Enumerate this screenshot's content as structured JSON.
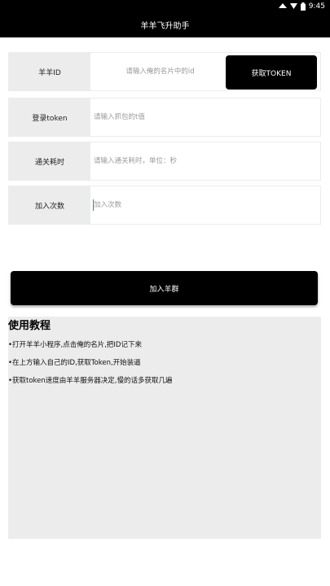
{
  "status_bar": {
    "time": "9:45"
  },
  "app_bar": {
    "title": "羊羊飞升助手"
  },
  "form": {
    "sheep_id": {
      "label": "羊羊ID",
      "placeholder": "请输入俺的名片中的id",
      "button_label": "获取TOKEN"
    },
    "login_token": {
      "label": "登录token",
      "placeholder": "请输入抓包的t值"
    },
    "clear_time": {
      "label": "通关耗时",
      "placeholder": "请输入通关耗时，单位：秒"
    },
    "join_count": {
      "label": "加入次数",
      "placeholder": "加入次数"
    }
  },
  "join_button": {
    "label": "加入羊群"
  },
  "tutorial": {
    "title": "使用教程",
    "items": [
      "•打开羊羊小程序,点击俺的名片,把ID记下来",
      "•在上方输入自己的ID,获取Token,开始装逼",
      "•获取token速度由羊羊服务器决定,慢的话多获取几遍"
    ]
  }
}
